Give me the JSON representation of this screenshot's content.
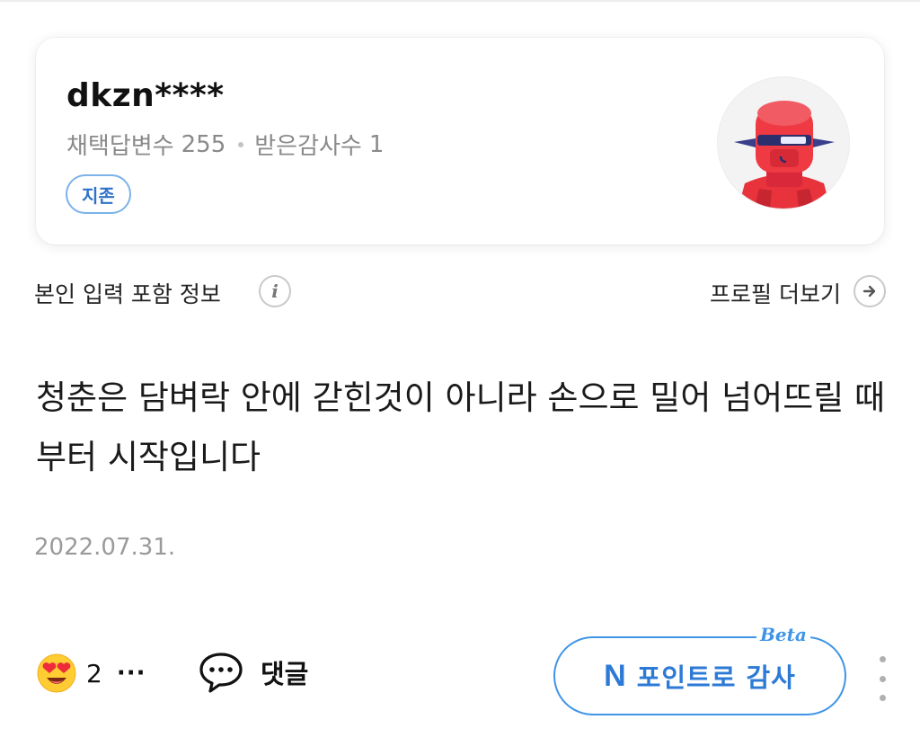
{
  "profile": {
    "username": "dkzn****",
    "adopted_answers_label": "채택답변수",
    "adopted_answers_count": "255",
    "thanks_received_label": "받은감사수",
    "thanks_received_count": "1",
    "grade": "지존",
    "avatar_icon": "red-robot-avatar"
  },
  "info_row": {
    "self_input_label": "본인 입력 포함 정보",
    "info_icon_glyph": "i",
    "profile_more_label": "프로필 더보기"
  },
  "answer": {
    "text": "청춘은 담벼락 안에 갇힌것이 아니라 손으로 밀어 넘어뜨릴 때부터 시작입니다",
    "date": "2022.07.31."
  },
  "actions": {
    "reaction_emoji": "heart-eyes-emoji",
    "reaction_count": "2",
    "reaction_more": "···",
    "comment_label": "댓글",
    "thanks_n": "N",
    "thanks_label": "포인트로 감사",
    "beta_label": "Beta"
  },
  "colors": {
    "accent_blue": "#2d7ad6",
    "badge_border": "#7bb2e8",
    "muted_text": "#8a8a8a",
    "avatar_red": "#e8323c"
  }
}
